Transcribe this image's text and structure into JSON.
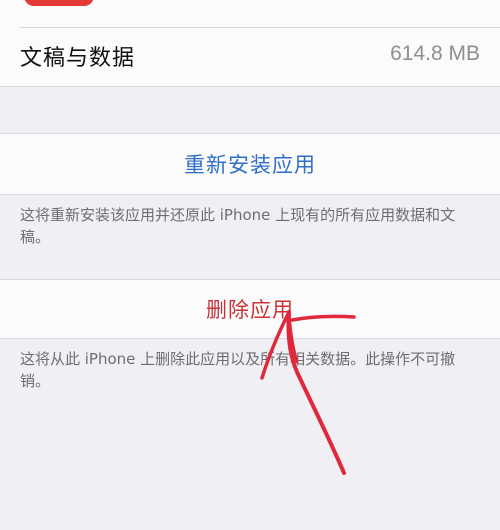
{
  "storage": {
    "documents_label": "文稿与数据",
    "documents_value": "614.8 MB"
  },
  "reinstall": {
    "button_label": "重新安装应用",
    "footnote": "这将重新安装该应用并还原此 iPhone 上现有的所有应用数据和文稿。"
  },
  "delete": {
    "button_label": "删除应用",
    "footnote": "这将从此 iPhone 上删除此应用以及所有相关数据。此操作不可撤销。"
  },
  "colors": {
    "background": "#efeff4",
    "cell": "#fbfbfb",
    "link_blue": "#2f6fc8",
    "destructive_red": "#c8343a",
    "annotation_red": "#e0283c"
  }
}
